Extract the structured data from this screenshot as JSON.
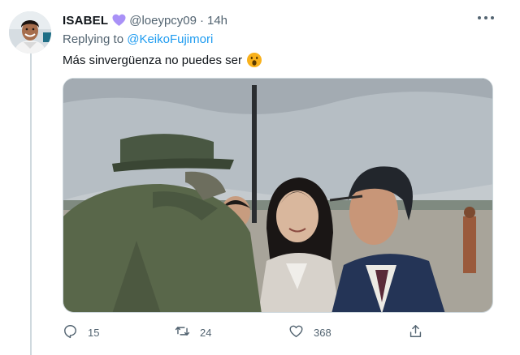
{
  "tweet": {
    "display_name": "ISABEL",
    "handle": "@loeypcy09",
    "separator": "·",
    "time": "14h",
    "replying_prefix": "Replying to",
    "replying_to": "@KeikoFujimori",
    "text": "Más sinvergüenza no puedes ser",
    "icons": {
      "name_badge": "purple-heart-emoji",
      "text_emoji": "open-mouth-face-emoji",
      "more": "more-dots-icon"
    }
  },
  "actions": {
    "replies": "15",
    "retweets": "24",
    "likes": "368",
    "icons": [
      "reply-icon",
      "retweet-icon",
      "like-icon",
      "share-icon"
    ]
  },
  "colors": {
    "text": "#0f1419",
    "secondary": "#536471",
    "link": "#1d9bf0",
    "heart": "#a991f7",
    "line": "#cfd9de"
  }
}
